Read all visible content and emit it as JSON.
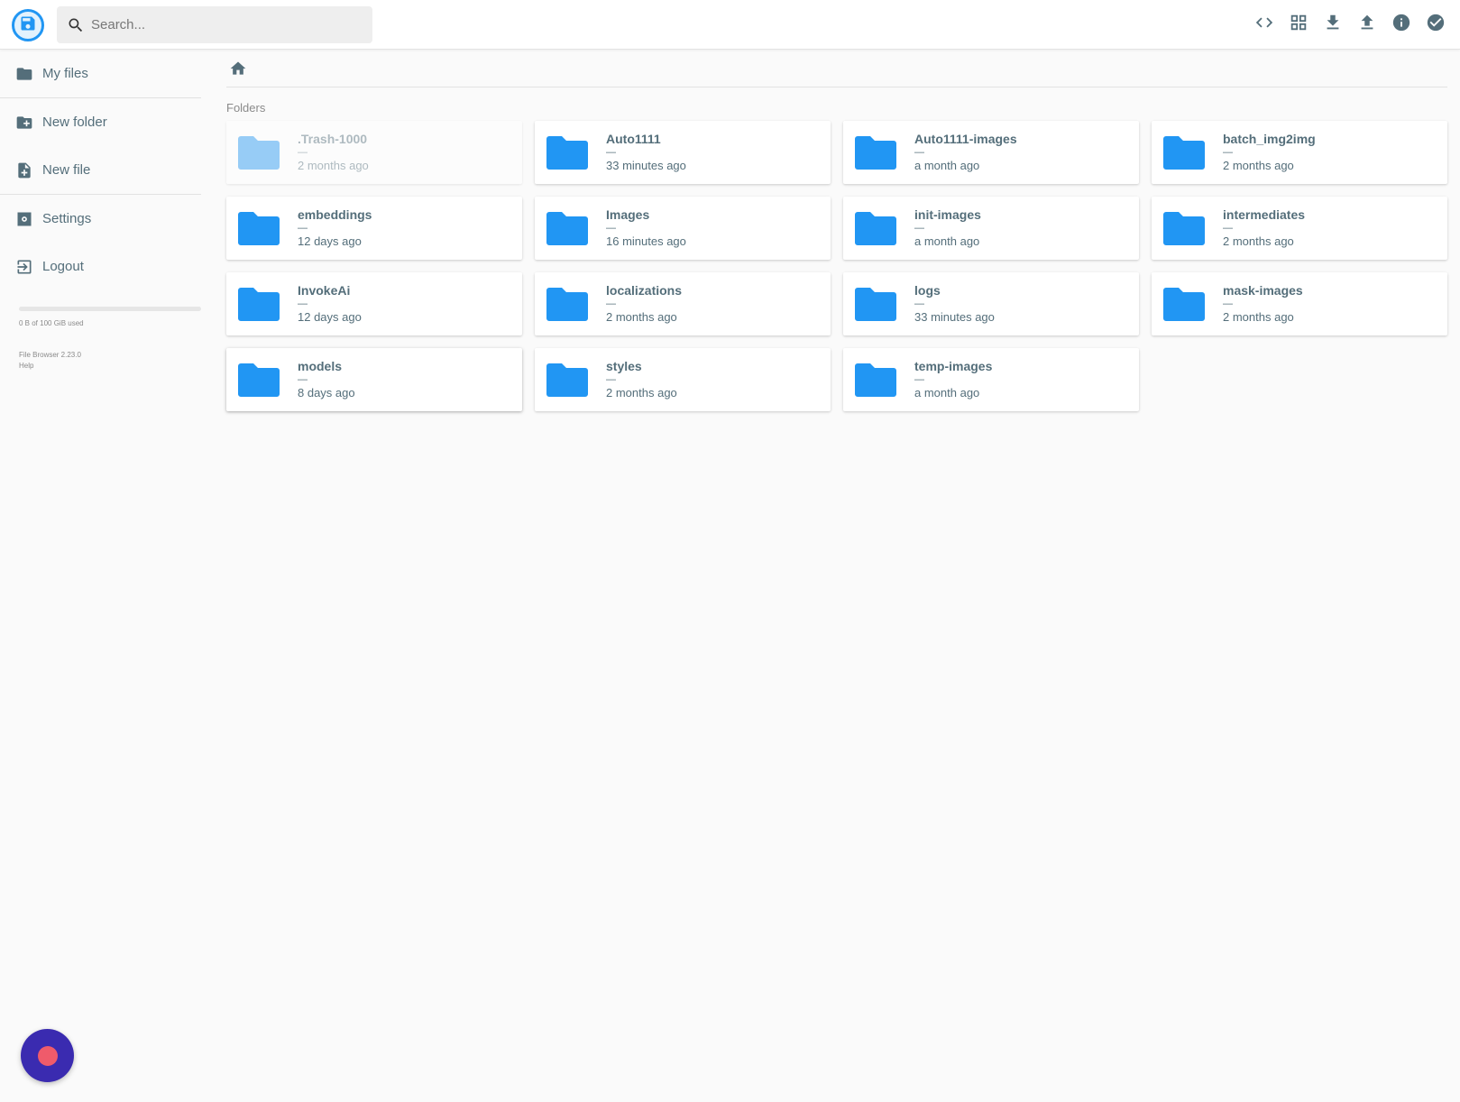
{
  "header": {
    "logo_icon": "floppy-disk-icon",
    "search": {
      "placeholder": "Search...",
      "value": ""
    },
    "actions": [
      {
        "name": "code-view-button",
        "icon": "code-brackets-icon"
      },
      {
        "name": "grid-view-button",
        "icon": "grid-icon"
      },
      {
        "name": "download-button",
        "icon": "download-icon"
      },
      {
        "name": "upload-button",
        "icon": "upload-icon"
      },
      {
        "name": "info-button",
        "icon": "info-icon"
      },
      {
        "name": "select-button",
        "icon": "check-circle-icon"
      }
    ]
  },
  "sidebar": {
    "items": [
      {
        "label": "My files",
        "icon": "folder-icon"
      },
      {
        "label": "New folder",
        "icon": "create-new-folder-icon"
      },
      {
        "label": "New file",
        "icon": "note-add-icon"
      },
      {
        "label": "Settings",
        "icon": "settings-icon"
      },
      {
        "label": "Logout",
        "icon": "exit-to-app-icon"
      }
    ],
    "usage": {
      "text": "0 B of 100 GiB used",
      "fraction": 0
    },
    "credits": {
      "version": "File Browser 2.23.0",
      "help": "Help"
    }
  },
  "main": {
    "breadcrumb_icon": "home-icon",
    "section_title": "Folders",
    "folders": [
      {
        "name": ".Trash-1000",
        "size": "—",
        "modified": "2 months ago",
        "faded": true
      },
      {
        "name": "Auto1111",
        "size": "—",
        "modified": "33 minutes ago"
      },
      {
        "name": "Auto1111-images",
        "size": "—",
        "modified": "a month ago"
      },
      {
        "name": "batch_img2img",
        "size": "—",
        "modified": "2 months ago"
      },
      {
        "name": "embeddings",
        "size": "—",
        "modified": "12 days ago"
      },
      {
        "name": "Images",
        "size": "—",
        "modified": "16 minutes ago"
      },
      {
        "name": "init-images",
        "size": "—",
        "modified": "a month ago"
      },
      {
        "name": "intermediates",
        "size": "—",
        "modified": "2 months ago"
      },
      {
        "name": "InvokeAi",
        "size": "—",
        "modified": "12 days ago"
      },
      {
        "name": "localizations",
        "size": "—",
        "modified": "2 months ago"
      },
      {
        "name": "logs",
        "size": "—",
        "modified": "33 minutes ago"
      },
      {
        "name": "mask-images",
        "size": "—",
        "modified": "2 months ago"
      },
      {
        "name": "models",
        "size": "—",
        "modified": "8 days ago",
        "focused": true
      },
      {
        "name": "styles",
        "size": "—",
        "modified": "2 months ago"
      },
      {
        "name": "temp-images",
        "size": "—",
        "modified": "a month ago"
      }
    ]
  },
  "colors": {
    "accent": "#2196f3",
    "text": "#546e7a",
    "fab": "#3a2bb0",
    "fab_dot": "#ef5b6b"
  }
}
